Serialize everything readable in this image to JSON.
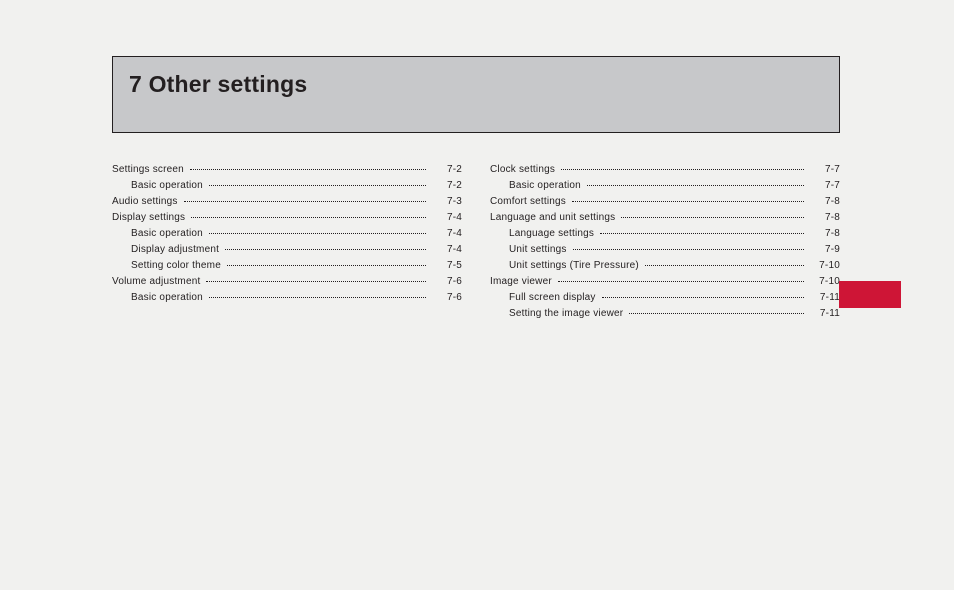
{
  "chapter": {
    "number": "7",
    "title": "Other settings"
  },
  "toc": {
    "columns": [
      [
        {
          "label": "Settings screen",
          "page": "7-2",
          "level": 0
        },
        {
          "label": "Basic operation",
          "page": "7-2",
          "level": 1
        },
        {
          "label": "Audio settings",
          "page": "7-3",
          "level": 0
        },
        {
          "label": "Display settings",
          "page": "7-4",
          "level": 0
        },
        {
          "label": "Basic operation",
          "page": "7-4",
          "level": 1
        },
        {
          "label": "Display adjustment",
          "page": "7-4",
          "level": 1
        },
        {
          "label": "Setting color theme",
          "page": "7-5",
          "level": 1
        },
        {
          "label": "Volume adjustment",
          "page": "7-6",
          "level": 0
        },
        {
          "label": "Basic operation",
          "page": "7-6",
          "level": 1
        }
      ],
      [
        {
          "label": "Clock settings",
          "page": "7-7",
          "level": 0
        },
        {
          "label": "Basic operation",
          "page": "7-7",
          "level": 1
        },
        {
          "label": "Comfort settings",
          "page": "7-8",
          "level": 0
        },
        {
          "label": "Language and unit settings",
          "page": "7-8",
          "level": 0
        },
        {
          "label": "Language settings",
          "page": "7-8",
          "level": 1
        },
        {
          "label": "Unit settings",
          "page": "7-9",
          "level": 1
        },
        {
          "label": "Unit settings (Tire Pressure)",
          "page": "7-10",
          "level": 1
        },
        {
          "label": "Image viewer",
          "page": "7-10",
          "level": 0
        },
        {
          "label": "Full screen display",
          "page": "7-11",
          "level": 1
        },
        {
          "label": "Setting the image viewer",
          "page": "7-11",
          "level": 1
        }
      ]
    ]
  },
  "colors": {
    "tab": "#ce1536",
    "header_bg": "#c7c8ca",
    "page_bg": "#f1f1ef"
  }
}
